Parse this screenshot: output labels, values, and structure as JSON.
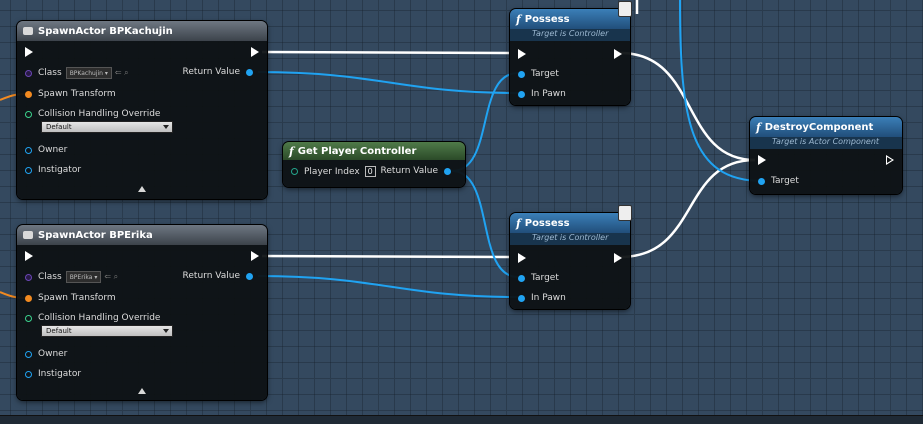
{
  "nodes": {
    "spawn_kachujin": {
      "title": "SpawnActor BPKachujin",
      "class_label": "Class",
      "class_value": "BPKachujin",
      "return_value": "Return Value",
      "spawn_transform": "Spawn Transform",
      "collision_label": "Collision Handling Override",
      "collision_value": "Default",
      "owner": "Owner",
      "instigator": "Instigator"
    },
    "spawn_erika": {
      "title": "SpawnActor BPErika",
      "class_label": "Class",
      "class_value": "BPErika",
      "return_value": "Return Value",
      "spawn_transform": "Spawn Transform",
      "collision_label": "Collision Handling Override",
      "collision_value": "Default",
      "owner": "Owner",
      "instigator": "Instigator"
    },
    "get_player_controller": {
      "title": "Get Player Controller",
      "player_index_label": "Player Index",
      "player_index_value": "0",
      "return_value": "Return Value"
    },
    "possess_1": {
      "title": "Possess",
      "subtitle": "Target is Controller",
      "target": "Target",
      "in_pawn": "In Pawn"
    },
    "possess_2": {
      "title": "Possess",
      "subtitle": "Target is Controller",
      "target": "Target",
      "in_pawn": "In Pawn"
    },
    "destroy_component": {
      "title": "DestroyComponent",
      "subtitle": "Target is Actor Component",
      "target": "Target"
    }
  },
  "glyphs": {
    "function": "f"
  },
  "colors": {
    "exec_wire": "#ffffff",
    "object_wire": "#20a3f2",
    "transform_pin": "#f28a20",
    "class_pin": "#6a46b4",
    "function_header": "#2a5d8f",
    "pure_header": "#3a6136"
  },
  "icons": [
    "spawn-icon",
    "network-icon",
    "function-icon",
    "collapse-arrow-icon",
    "dropdown-arrow-icon"
  ]
}
